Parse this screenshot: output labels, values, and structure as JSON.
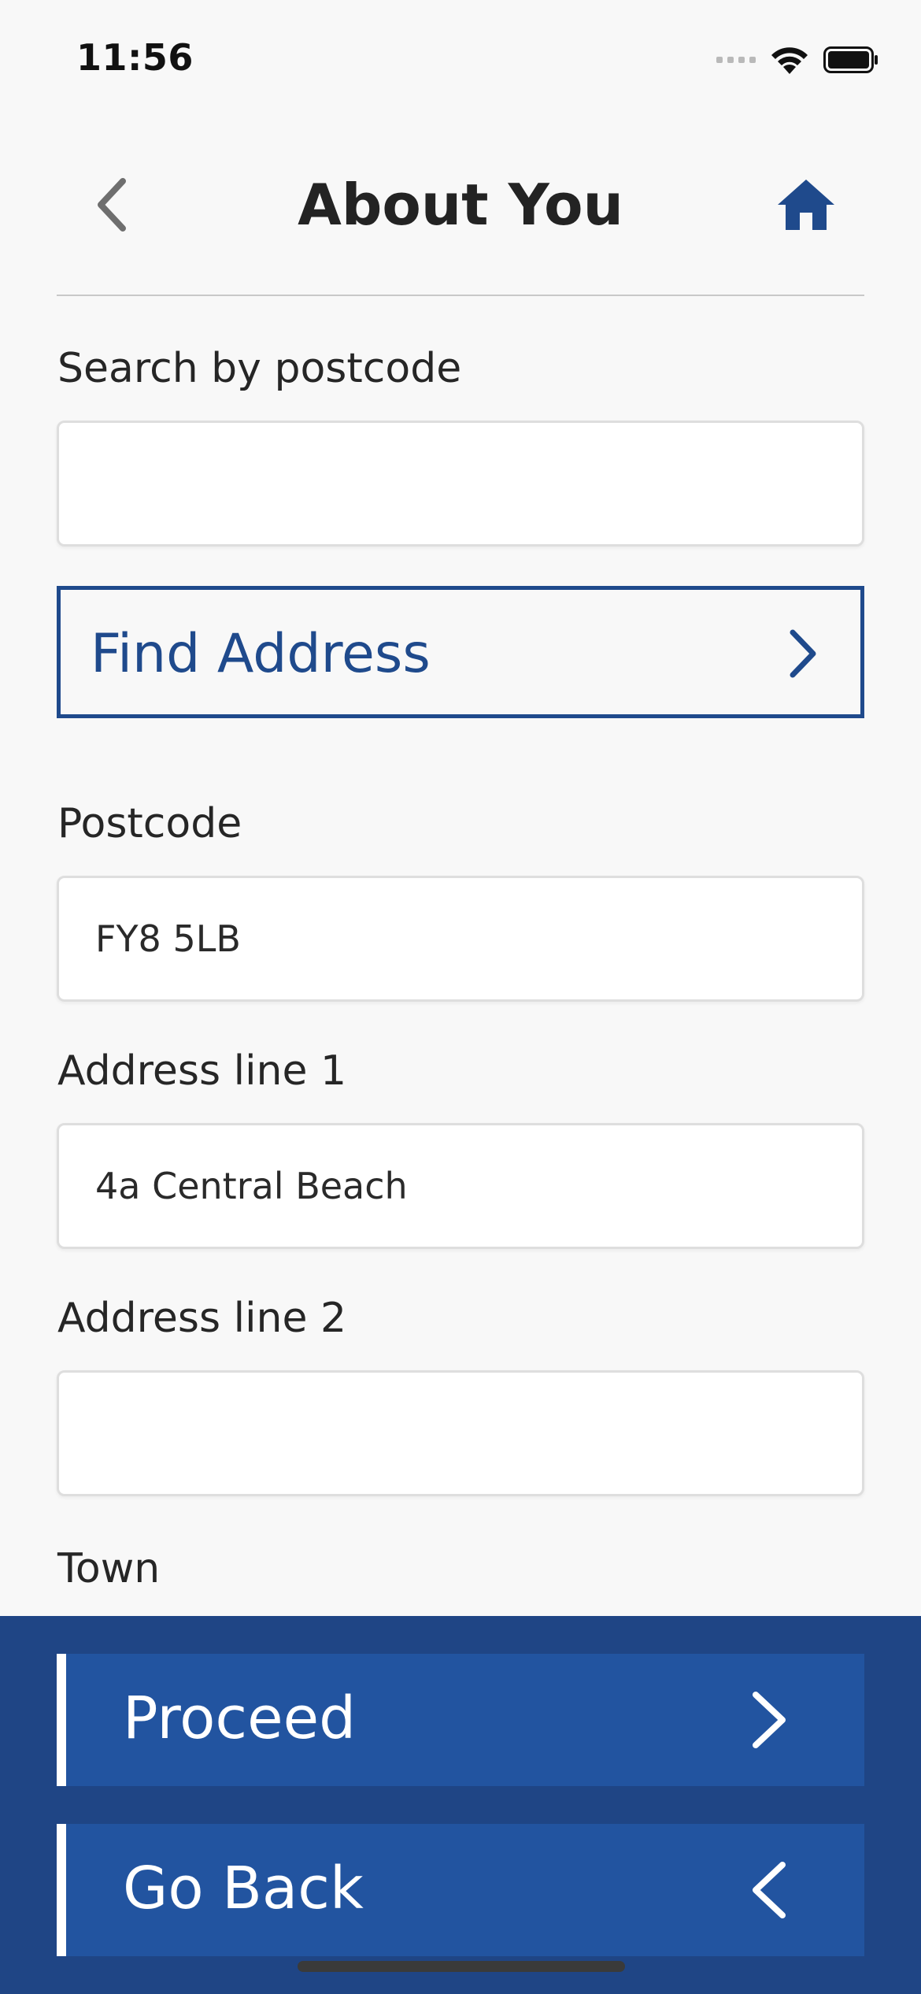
{
  "status_bar": {
    "time": "11:56",
    "icons": [
      "cellular-signal-icon",
      "wifi-icon",
      "battery-icon"
    ]
  },
  "header": {
    "title": "About You",
    "back_icon": "chevron-left-icon",
    "home_icon": "home-icon"
  },
  "form": {
    "search": {
      "label": "Search by postcode",
      "value": "",
      "placeholder": ""
    },
    "find_button": {
      "label": "Find Address",
      "icon": "chevron-right-icon"
    },
    "postcode": {
      "label": "Postcode",
      "value": "FY8 5LB"
    },
    "address_line_1": {
      "label": "Address line 1",
      "value": "4a Central Beach"
    },
    "address_line_2": {
      "label": "Address line 2",
      "value": ""
    },
    "town": {
      "label": "Town"
    }
  },
  "actions": {
    "proceed": {
      "label": "Proceed",
      "icon": "chevron-right-icon"
    },
    "go_back": {
      "label": "Go Back",
      "icon": "chevron-left-icon"
    }
  },
  "colors": {
    "brand_blue": "#1f4a8c",
    "panel_blue": "#1f4585",
    "button_blue": "#2254a0",
    "background": "#f8f8f8"
  }
}
